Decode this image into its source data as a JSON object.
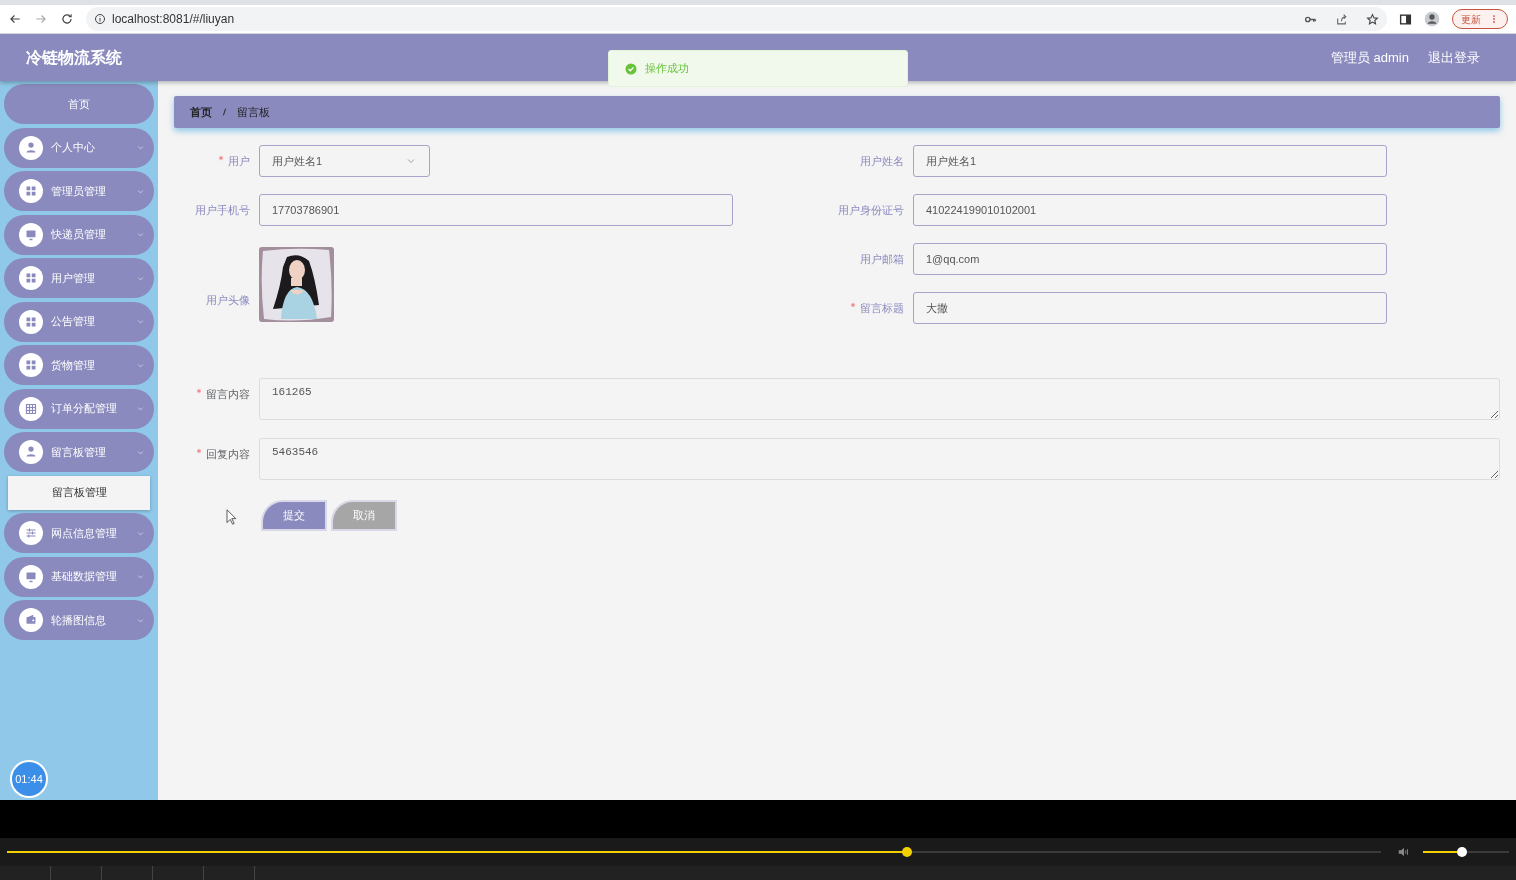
{
  "browser": {
    "url": "localhost:8081/#/liuyan",
    "update_button": "更新"
  },
  "header": {
    "title": "冷链物流系统",
    "user": "管理员 admin",
    "logout": "退出登录"
  },
  "toast": {
    "message": "操作成功"
  },
  "sidebar": {
    "items": [
      {
        "kind": "link",
        "label": "首页"
      },
      {
        "kind": "menu",
        "label": "个人中心"
      },
      {
        "kind": "menu",
        "label": "管理员管理"
      },
      {
        "kind": "menu",
        "label": "快递员管理"
      },
      {
        "kind": "menu",
        "label": "用户管理"
      },
      {
        "kind": "menu",
        "label": "公告管理"
      },
      {
        "kind": "menu",
        "label": "货物管理"
      },
      {
        "kind": "menu",
        "label": "订单分配管理"
      },
      {
        "kind": "menu",
        "label": "留言板管理",
        "children": [
          {
            "label": "留言板管理"
          }
        ]
      },
      {
        "kind": "menu",
        "label": "网点信息管理"
      },
      {
        "kind": "menu",
        "label": "基础数据管理"
      },
      {
        "kind": "menu",
        "label": "轮播图信息"
      }
    ]
  },
  "timer": "01:44",
  "breadcrumb": [
    "首页",
    "留言板"
  ],
  "form": {
    "left_fields": [
      {
        "kind": "select",
        "label": "用户",
        "required": true,
        "value": "用户姓名1"
      },
      {
        "kind": "input",
        "label": "用户手机号",
        "required": false,
        "value": "17703786901"
      },
      {
        "label": "用户头像",
        "required": false
      }
    ],
    "right_fields": [
      {
        "kind": "input",
        "label": "用户姓名",
        "required": false,
        "value": "用户姓名1"
      },
      {
        "kind": "input",
        "label": "用户身份证号",
        "required": false,
        "value": "410224199010102001"
      },
      {
        "kind": "input",
        "label": "用户邮箱",
        "required": false,
        "value": "1@qq.com"
      },
      {
        "kind": "input",
        "label": "留言标题",
        "required": true,
        "value": "大撒"
      }
    ],
    "textareas": [
      {
        "label": "留言内容",
        "required": true,
        "value": "161265"
      },
      {
        "label": "回复内容",
        "required": true,
        "value": "5463546"
      }
    ],
    "buttons": [
      {
        "kind": "primary",
        "label": "提交"
      },
      {
        "kind": "secondary",
        "label": "取消"
      }
    ]
  },
  "player": {
    "progress": {
      "level": 0.655
    },
    "volume": {
      "level": 0.45
    }
  }
}
